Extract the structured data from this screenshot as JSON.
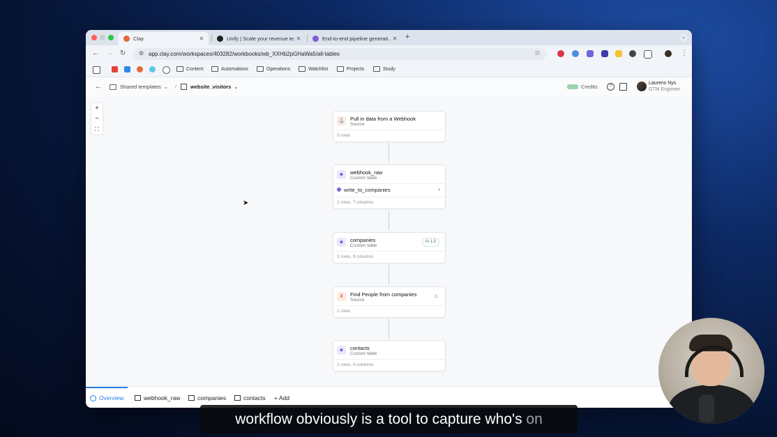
{
  "browser": {
    "tabs": [
      {
        "title": "Clay",
        "color": "#e9663d",
        "active": true
      },
      {
        "title": "Unify | Scale your revenue te…",
        "color": "#222222",
        "active": false
      },
      {
        "title": "End-to-end pipeline generati…",
        "color": "#7c5cd8",
        "active": false
      }
    ],
    "url": "app.clay.com/workspaces/403282/workbooks/wb_XXHb2pGHaWa5/all-tables",
    "bookmarks": [
      "Content",
      "Automations",
      "Operations",
      "Watchlist",
      "Projects",
      "Study"
    ]
  },
  "app": {
    "breadcrumb": {
      "parent": "Shared templates",
      "current": "website_visitors"
    },
    "credits_label": "Credits",
    "user": {
      "name": "Laurens Nys",
      "role": "GTM Engineer"
    }
  },
  "nodes": [
    {
      "title": "Pull in data from a Webhook",
      "subtitle": "Source",
      "meta": "0 rows"
    },
    {
      "title": "webhook_raw",
      "subtitle": "Custom table",
      "link": "write_to_companies",
      "meta": "1 rows, 7 columns"
    },
    {
      "title": "companies",
      "subtitle": "Custom table",
      "badge": "1.5",
      "meta": "1 rows, 9 columns"
    },
    {
      "title": "Find People from companies",
      "subtitle": "Source",
      "meta": "1 rows"
    },
    {
      "title": "contacts",
      "subtitle": "Custom table",
      "meta": "1 rows, 4 columns"
    }
  ],
  "footer_tabs": [
    "Overview",
    "webhook_raw",
    "companies",
    "contacts",
    "+ Add"
  ],
  "caption": {
    "main": "workflow obviously is a tool to capture who's ",
    "fade": "on"
  }
}
